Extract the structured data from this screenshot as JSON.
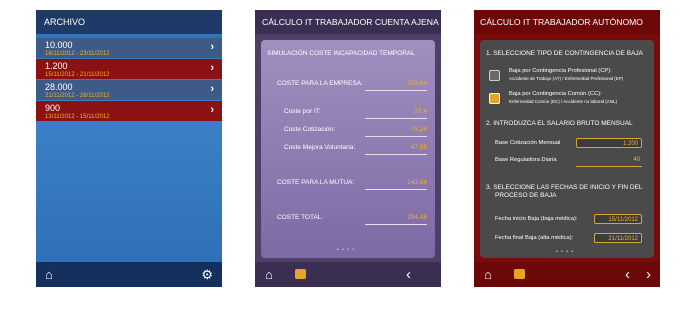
{
  "screen1": {
    "title": "ARCHIVO",
    "items": [
      {
        "value": "10.000",
        "dates": "16/11/2012 - 23/11/2012"
      },
      {
        "value": "1.200",
        "dates": "15/11/2012 - 21/11/2012"
      },
      {
        "value": "28.000",
        "dates": "21/11/2012 - 26/11/2012"
      },
      {
        "value": "900",
        "dates": "13/11/2012 - 15/11/2012"
      }
    ],
    "chevron": "›",
    "home_icon": "⌂",
    "gear_icon": "⚙"
  },
  "screen2": {
    "title": "CÁLCULO IT TRABAJADOR CUENTA AJENA",
    "subtitle": "SIMULACIÓN COSTE INCAPACIDAD TEMPORAL",
    "rows": [
      {
        "label": "COSTE PARA LA EMPRESA:",
        "value": "150,64"
      },
      {
        "label": "Coste por IT:",
        "value": "27,4"
      },
      {
        "label": "Coste Cotización:",
        "value": "75,29"
      },
      {
        "label": "Coste Mejora Voluntaria:",
        "value": "47,95"
      },
      {
        "label": "COSTE PARA LA MUTUA:",
        "value": "143,84"
      },
      {
        "label": "COSTE TOTAL:",
        "value": "294,48"
      }
    ],
    "dots": "• • • •",
    "home_icon": "⌂",
    "back_icon": "‹"
  },
  "screen3": {
    "title": "CÁLCULO IT TRABAJADOR AUTÓNOMO",
    "sec1": "1. SELECCIONE TIPO DE CONTINGENCIA DE BAJA",
    "opt1_title": "Baja por Contingencia Profesional (CP):",
    "opt1_sub": "Accidente de Trabajo (AT) / Enfermedad Profesional (EP)",
    "opt2_title": "Baja por Contingencia Común (CC):",
    "opt2_sub": "Enfermedad Común (EC) / Accidente no laboral (ANL)",
    "sec2": "2. INTRODUZCA EL SALARIO BRUTO MENSUAL",
    "base_cot_label": "Base Cotización Mensual",
    "base_cot_value": "1.200",
    "base_reg_label": "Base Reguladora Diaria",
    "base_reg_value": "40",
    "sec3_line1": "3. SELECCIONE LAS FECHAS DE INICIO Y  FIN DEL",
    "sec3_line2": "PROCESO DE BAJA",
    "fecha_inicio_label": "Fecha inicio Baja (baja médica):",
    "fecha_inicio_value": "15/11/2012",
    "fecha_final_label": "Fecha final Baja (alta médica):",
    "fecha_final_value": "21/11/2012",
    "dots": "• • • •",
    "home_icon": "⌂",
    "prev_icon": "‹",
    "next_icon": "›"
  },
  "colors": {
    "accent": "#f0b12a",
    "blue_header": "#1f3a66",
    "purple_header": "#3a2e52",
    "red_header": "#6c0808"
  }
}
